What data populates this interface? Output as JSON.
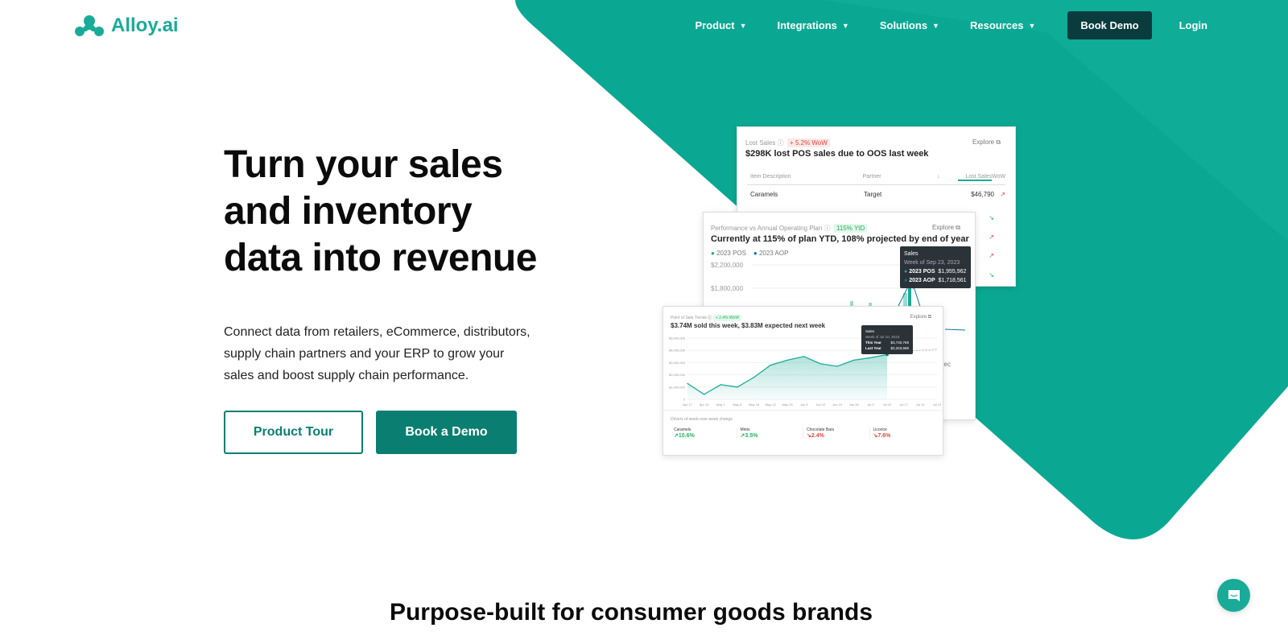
{
  "colors": {
    "brand": "#1aab98",
    "bg_shape": "#0aa892",
    "dark_button": "#0b3c3d",
    "cta": "#0a7f71"
  },
  "logo": {
    "text": "Alloy.ai"
  },
  "nav": {
    "items": [
      {
        "label": "Product"
      },
      {
        "label": "Integrations"
      },
      {
        "label": "Solutions"
      },
      {
        "label": "Resources"
      }
    ],
    "book_demo": "Book Demo",
    "login": "Login"
  },
  "hero": {
    "title": "Turn your sales and inventory data into revenue",
    "subtitle": "Connect data from retailers, eCommerce, distributors, supply chain partners and your ERP  to grow your sales and boost supply chain performance.",
    "product_tour": "Product Tour",
    "book_demo": "Book a Demo"
  },
  "lost_sales": {
    "label": "Lost Sales",
    "badge": "+ 5.2% WoW",
    "explore": "Explore",
    "title": "$298K lost POS sales due to OOS last week",
    "headers": [
      "Item Description",
      "Partner",
      "↓",
      "Lost Sales",
      "WoW"
    ],
    "rows": [
      {
        "item": "Caramels",
        "partner": "Target",
        "value": "$46,790",
        "trend": "up"
      }
    ]
  },
  "plan": {
    "label": "Performance vs Annual Operating Plan",
    "badge": "115% YtD",
    "explore": "Explore",
    "title": "Currently at 115% of plan YTD, 108% projected by end of year",
    "legend": [
      "2023 POS",
      "2023 AOP"
    ],
    "yticks": [
      "$2,200,000",
      "$1,800,000"
    ],
    "xtick": "Dec",
    "tooltip": {
      "title": "Sales",
      "week": "Week of Sep 23, 2023",
      "pos_label": "2023 POS",
      "pos_value": "$1,955,962",
      "aop_label": "2023 AOP",
      "aop_value": "$1,718,561"
    }
  },
  "pos": {
    "label": "Point of Sale Trends",
    "badge": "+ 2.4% WoW",
    "explore": "Explore",
    "title": "$3.74M sold this week, $3.83M expected next week",
    "tooltip": {
      "title": "Sales",
      "week": "Week of Jul 10, 2023",
      "ty_label": "This Year",
      "ty_value": "$3,740,769",
      "ly_label": "Last Year",
      "ly_value": "$3,263,589"
    },
    "drivers_label": "Drivers of week-over-week change",
    "drivers": [
      {
        "name": "Caramels",
        "value": "↗10.6%",
        "dir": "up"
      },
      {
        "name": "Mints",
        "value": "↗3.5%",
        "dir": "up"
      },
      {
        "name": "Chocolate Bars",
        "value": "↘2.4%",
        "dir": "down"
      },
      {
        "name": "Licorice",
        "value": "↘7.6%",
        "dir": "down"
      }
    ]
  },
  "chart_data": {
    "type": "area",
    "x": [
      "Apr 17",
      "Apr 24",
      "May 1",
      "May 8",
      "May 15",
      "May 22",
      "May 29",
      "Jun 5",
      "Jun 12",
      "Jun 19",
      "Jun 26",
      "Jul 3",
      "Jul 10",
      "Jul 17",
      "Jul 24",
      "Jul 31"
    ],
    "yticks": [
      "0",
      "$1,000,000",
      "$2,000,000",
      "$3,000,000",
      "$4,000,000",
      "$5,000,000"
    ],
    "ylim": [
      0,
      5000000
    ],
    "series": [
      {
        "values": [
          1300000,
          400000,
          1200000,
          1000000,
          1800000,
          2800000,
          3200000,
          3500000,
          2900000,
          2700000,
          3200000,
          3400000,
          3650000,
          null,
          null,
          null
        ]
      },
      {
        "values": [
          null,
          null,
          null,
          null,
          null,
          null,
          null,
          null,
          null,
          null,
          null,
          null,
          3650000,
          3900000,
          4000000,
          4100000
        ],
        "style": "dashed-forecast"
      }
    ]
  },
  "section": {
    "title": "Purpose-built for consumer goods brands"
  }
}
